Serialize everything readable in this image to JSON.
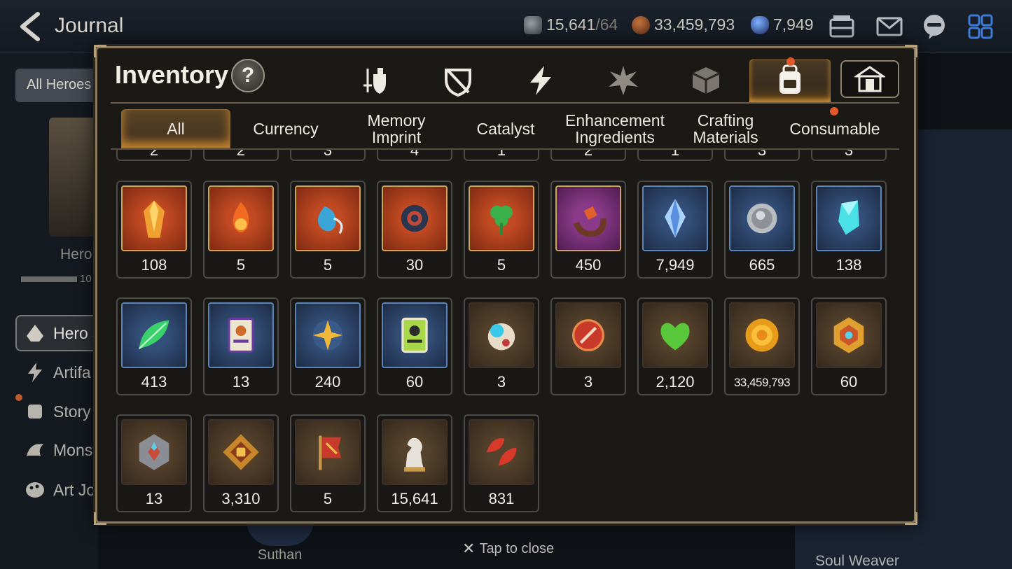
{
  "header": {
    "title": "Journal",
    "stamina_value": "15,641",
    "stamina_max": "/64",
    "gold_value": "33,459,793",
    "crystal_value": "7,949"
  },
  "sidebar": {
    "filter_label": "All Heroes",
    "hero_label": "Hero",
    "hero_count": "10",
    "items": [
      {
        "label": "Hero J"
      },
      {
        "label": "Artifa"
      },
      {
        "label": "Story"
      },
      {
        "label": "Monst"
      },
      {
        "label": "Art Jo"
      }
    ]
  },
  "background": {
    "hero_name": "Suthan",
    "right_label": "Soul Weaver",
    "tap_to_close": "Tap to close"
  },
  "inventory": {
    "title": "Inventory",
    "help_glyph": "?",
    "category_icons": [
      "sword-shield-icon",
      "broken-shield-icon",
      "lightning-icon",
      "spirit-burst-icon",
      "cube-icon",
      "backpack-icon"
    ],
    "active_category": 5,
    "subtabs": [
      {
        "label": "All"
      },
      {
        "label": "Currency"
      },
      {
        "label": "Memory Imprint"
      },
      {
        "label": "Catalyst"
      },
      {
        "label": "Enhancement Ingredients"
      },
      {
        "label": "Crafting Materials"
      },
      {
        "label": "Consumable"
      }
    ],
    "active_subtab": 0,
    "items": [
      {
        "icon": "flame-crystal-icon",
        "frame": "red",
        "qty": "108"
      },
      {
        "icon": "fire-charm-icon",
        "frame": "red",
        "qty": "5"
      },
      {
        "icon": "water-charm-icon",
        "frame": "red",
        "qty": "5"
      },
      {
        "icon": "moon-charm-icon",
        "frame": "red",
        "qty": "30"
      },
      {
        "icon": "clover-charm-icon",
        "frame": "red",
        "qty": "5"
      },
      {
        "icon": "crescent-ring-icon",
        "frame": "purple",
        "qty": "450"
      },
      {
        "icon": "blue-crystal-icon",
        "frame": "blue",
        "qty": "7,949"
      },
      {
        "icon": "silver-coin-icon",
        "frame": "blue",
        "qty": "665"
      },
      {
        "icon": "cyan-crystal-icon",
        "frame": "blue",
        "qty": "138"
      },
      {
        "icon": "green-leaf-icon",
        "frame": "blue",
        "qty": "413"
      },
      {
        "icon": "summon-card-icon",
        "frame": "blue",
        "qty": "13"
      },
      {
        "icon": "star-charm-icon",
        "frame": "blue",
        "qty": "240"
      },
      {
        "icon": "green-card-icon",
        "frame": "blue",
        "qty": "60"
      },
      {
        "icon": "capsule-icon",
        "frame": "brown",
        "qty": "3"
      },
      {
        "icon": "red-badge-icon",
        "frame": "brown",
        "qty": "3"
      },
      {
        "icon": "green-heart-icon",
        "frame": "brown",
        "qty": "2,120"
      },
      {
        "icon": "gold-coin-icon",
        "frame": "brown",
        "qty": "33,459,793"
      },
      {
        "icon": "gold-emblem-icon",
        "frame": "brown",
        "qty": "60"
      },
      {
        "icon": "stone-cube-icon",
        "frame": "brown",
        "qty": "13"
      },
      {
        "icon": "fist-medal-icon",
        "frame": "brown",
        "qty": "3,310"
      },
      {
        "icon": "war-banner-icon",
        "frame": "brown",
        "qty": "5"
      },
      {
        "icon": "knight-piece-icon",
        "frame": "brown",
        "qty": "15,641"
      },
      {
        "icon": "red-leaf-icon",
        "frame": "brown",
        "qty": "831"
      }
    ],
    "partial_row_qty": [
      "2",
      "2",
      "3",
      "4",
      "1",
      "2",
      "1",
      "3",
      "3"
    ]
  }
}
